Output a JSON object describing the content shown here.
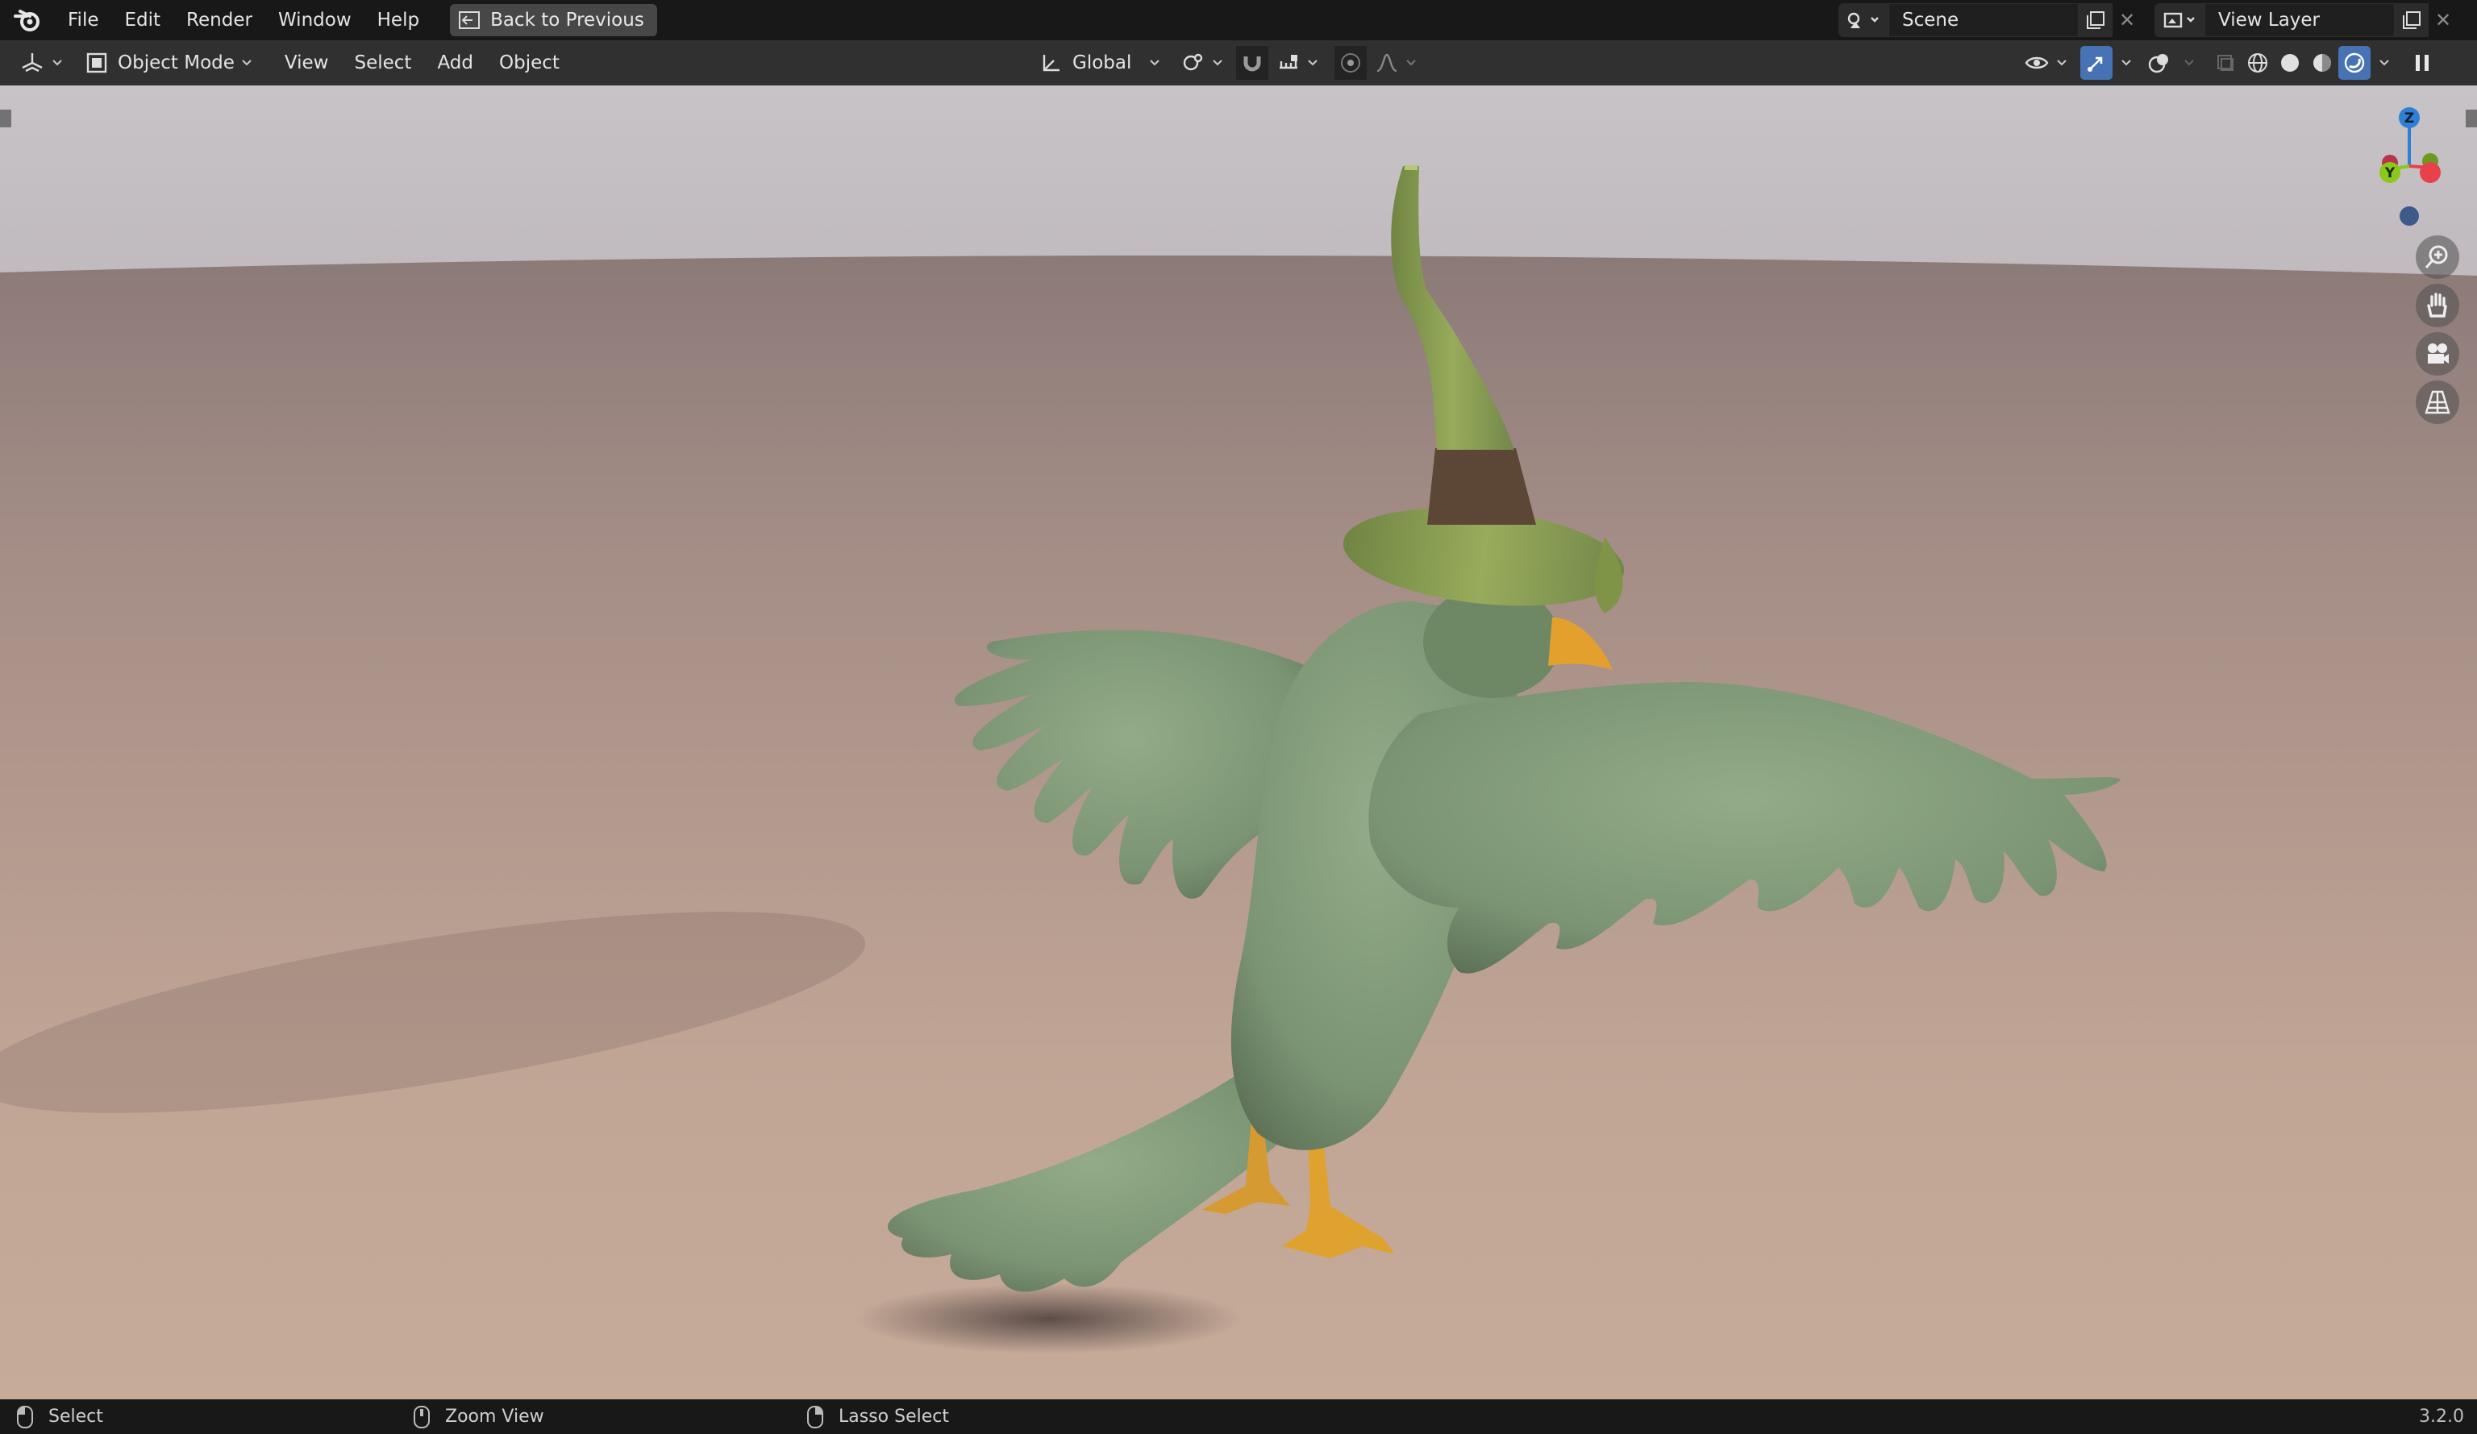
{
  "topbar": {
    "menus": [
      "File",
      "Edit",
      "Render",
      "Window",
      "Help"
    ],
    "back_label": "Back to Previous",
    "scene_name": "Scene",
    "view_layer_name": "View Layer"
  },
  "toolbar": {
    "mode_label": "Object Mode",
    "menus": [
      "View",
      "Select",
      "Add",
      "Object"
    ],
    "transform_orientation": "Global"
  },
  "gizmo": {
    "z_label": "Z",
    "y_label": "Y",
    "colors": {
      "x": "#e8414b",
      "y": "#8bc81c",
      "z": "#2e7fd6",
      "neg": "#3d5a8a"
    }
  },
  "statusbar": {
    "select_label": "Select",
    "zoom_label": "Zoom View",
    "lasso_label": "Lasso Select",
    "version": "3.2.0"
  },
  "theme": {
    "accent": "#4772b3",
    "feather_green": "#7f9a78",
    "hat_green": "#8a9e52",
    "hat_band": "#5c4636",
    "beak_orange": "#e3a02c"
  }
}
